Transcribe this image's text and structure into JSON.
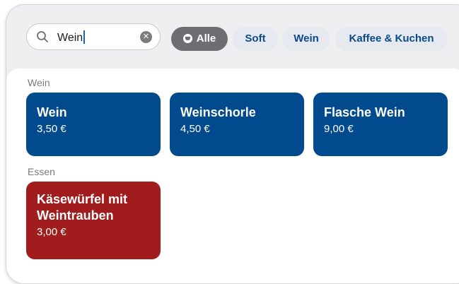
{
  "search": {
    "value": "Wein",
    "clear_icon": "clear-icon",
    "search_icon": "search-icon"
  },
  "filters": [
    {
      "label": "Alle",
      "selected": true,
      "icon": "drink-icon"
    },
    {
      "label": "Soft",
      "selected": false
    },
    {
      "label": "Wein",
      "selected": false
    },
    {
      "label": "Kaffee & Kuchen",
      "selected": false
    }
  ],
  "sections": [
    {
      "title": "Wein",
      "items": [
        {
          "name": "Wein",
          "price": "3,50 €"
        },
        {
          "name": "Weinschorle",
          "price": "4,50 €"
        },
        {
          "name": "Flasche Wein",
          "price": "9,00 €"
        }
      ]
    },
    {
      "title": "Essen",
      "items": [
        {
          "name": "Käsewürfel mit Weintrauben",
          "price": "3,00 €"
        }
      ]
    }
  ],
  "colors": {
    "drink_tile": "#004a8d",
    "food_tile": "#a11d1d",
    "chip_selected": "#6e6e72",
    "chip_default": "#e6eaf0",
    "chip_text": "#0b4a8a"
  }
}
